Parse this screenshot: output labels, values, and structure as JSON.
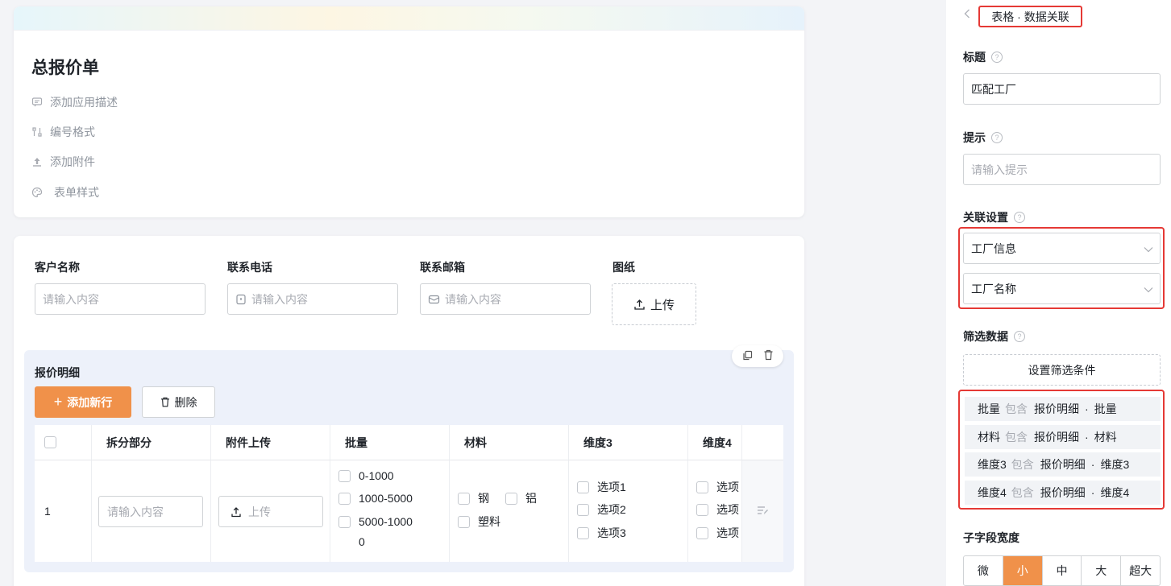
{
  "form": {
    "title": "总报价单",
    "meta": [
      "添加应用描述",
      "编号格式",
      "添加附件",
      "表单样式"
    ]
  },
  "fields": [
    {
      "label": "客户名称",
      "placeholder": "请输入内容"
    },
    {
      "label": "联系电话",
      "placeholder": "请输入内容"
    },
    {
      "label": "联系邮箱",
      "placeholder": "请输入内容"
    },
    {
      "label": "图纸",
      "upload_label": "上传"
    }
  ],
  "subform": {
    "title": "报价明细",
    "add_label": "添加新行",
    "delete_label": "删除",
    "columns": [
      "拆分部分",
      "附件上传",
      "批量",
      "材料",
      "维度3",
      "维度4"
    ],
    "row": {
      "index": "1",
      "input_placeholder": "请输入内容",
      "upload_label": "上传",
      "batch_options": [
        "0-1000",
        "1000-5000",
        "5000-1000",
        "0"
      ],
      "material_options": [
        "钢",
        "铝",
        "塑料"
      ],
      "dim3_options": [
        "选项1",
        "选项2",
        "选项3"
      ],
      "dim4_options": [
        "选项",
        "选项",
        "选项"
      ]
    }
  },
  "panel": {
    "breadcrumb": "表格 · 数据关联",
    "title_label": "标题",
    "title_value": "匹配工厂",
    "hint_label": "提示",
    "hint_placeholder": "请输入提示",
    "relation_label": "关联设置",
    "relation_form": "工厂信息",
    "relation_field": "工厂名称",
    "filter_label": "筛选数据",
    "filter_button": "设置筛选条件",
    "filters": [
      {
        "field": "批量",
        "op": "包含",
        "source": "报价明细",
        "target": "批量"
      },
      {
        "field": "材料",
        "op": "包含",
        "source": "报价明细",
        "target": "材料"
      },
      {
        "field": "维度3",
        "op": "包含",
        "source": "报价明细",
        "target": "维度3"
      },
      {
        "field": "维度4",
        "op": "包含",
        "source": "报价明细",
        "target": "维度4"
      }
    ],
    "width_label": "子字段宽度",
    "width_options": [
      "微",
      "小",
      "中",
      "大",
      "超大"
    ]
  },
  "colors": {
    "accent": "#f0914a",
    "highlight": "#e53935"
  }
}
